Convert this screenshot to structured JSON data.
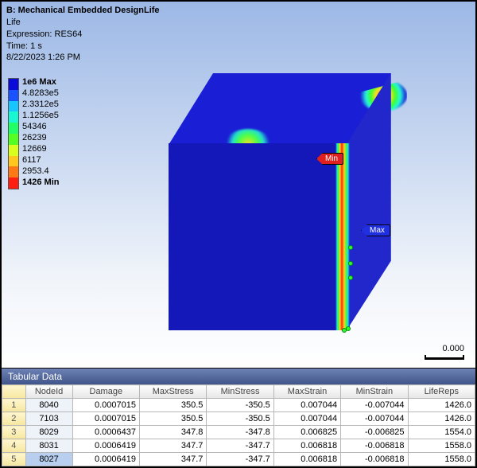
{
  "header": {
    "title": "B: Mechanical Embedded DesignLife",
    "result": "Life",
    "expression": "Expression: RES64",
    "time": "Time: 1 s",
    "timestamp": "8/22/2023 1:26 PM"
  },
  "legend": {
    "max_label": "1e6 Max",
    "levels": [
      "4.8283e5",
      "2.3312e5",
      "1.1256e5",
      "54346",
      "26239",
      "12669",
      "6117",
      "2953.4"
    ],
    "min_label": "1426 Min",
    "colors": [
      "#0b0bd9",
      "#1952ff",
      "#17c6ff",
      "#17f7d1",
      "#22ff66",
      "#55ff22",
      "#d8ff1d",
      "#ffc81d",
      "#ff7a16",
      "#ff1e10"
    ]
  },
  "callouts": {
    "min": "Min",
    "max": "Max"
  },
  "scalebar": {
    "value": "0.000"
  },
  "table": {
    "title": "Tabular Data",
    "columns": [
      "NodeId",
      "Damage",
      "MaxStress",
      "MinStress",
      "MaxStrain",
      "MinStrain",
      "LifeReps"
    ],
    "rows": [
      {
        "n": 1,
        "sel": false,
        "cells": [
          "8040",
          "0.0007015",
          "350.5",
          "-350.5",
          "0.007044",
          "-0.007044",
          "1426.0"
        ]
      },
      {
        "n": 2,
        "sel": false,
        "cells": [
          "7103",
          "0.0007015",
          "350.5",
          "-350.5",
          "0.007044",
          "-0.007044",
          "1426.0"
        ]
      },
      {
        "n": 3,
        "sel": false,
        "cells": [
          "8029",
          "0.0006437",
          "347.8",
          "-347.8",
          "0.006825",
          "-0.006825",
          "1554.0"
        ]
      },
      {
        "n": 4,
        "sel": false,
        "cells": [
          "8031",
          "0.0006419",
          "347.7",
          "-347.7",
          "0.006818",
          "-0.006818",
          "1558.0"
        ]
      },
      {
        "n": 5,
        "sel": true,
        "cells": [
          "8027",
          "0.0006419",
          "347.7",
          "-347.7",
          "0.006818",
          "-0.006818",
          "1558.0"
        ]
      }
    ]
  }
}
